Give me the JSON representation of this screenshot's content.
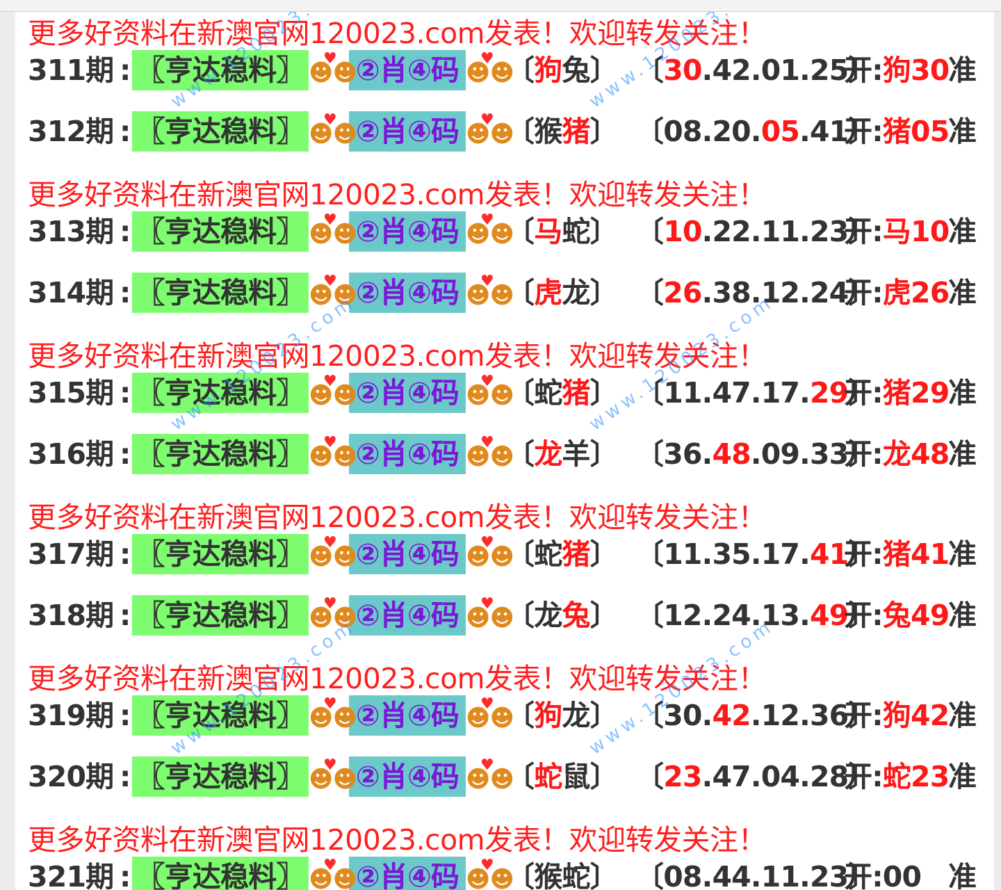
{
  "promo_text": "更多好资料在新澳官网120023.com发表！欢迎转发关注！",
  "tag_green": "〖亨达稳料〗",
  "tag_teal": "②肖④码",
  "open_label": "开:",
  "hit_label": "准",
  "watermark": "www.120023.com",
  "rows": [
    {
      "period": "311期",
      "a1": "狗",
      "a2": "兔",
      "n1": "30",
      "n2": "42",
      "n3": "01",
      "n4": "25",
      "open_animal": "狗",
      "open_num": "30",
      "hl": {
        "a1": true,
        "a2": false,
        "n1": true,
        "n2": false,
        "n3": false,
        "n4": false
      }
    },
    {
      "period": "312期",
      "a1": "猴",
      "a2": "猪",
      "n1": "08",
      "n2": "20",
      "n3": "05",
      "n4": "41",
      "open_animal": "猪",
      "open_num": "05",
      "hl": {
        "a1": false,
        "a2": true,
        "n1": false,
        "n2": false,
        "n3": true,
        "n4": false
      }
    },
    {
      "period": "313期",
      "a1": "马",
      "a2": "蛇",
      "n1": "10",
      "n2": "22",
      "n3": "11",
      "n4": "23",
      "open_animal": "马",
      "open_num": "10",
      "hl": {
        "a1": true,
        "a2": false,
        "n1": true,
        "n2": false,
        "n3": false,
        "n4": false
      }
    },
    {
      "period": "314期",
      "a1": "虎",
      "a2": "龙",
      "n1": "26",
      "n2": "38",
      "n3": "12",
      "n4": "24",
      "open_animal": "虎",
      "open_num": "26",
      "hl": {
        "a1": true,
        "a2": false,
        "n1": true,
        "n2": false,
        "n3": false,
        "n4": false
      }
    },
    {
      "period": "315期",
      "a1": "蛇",
      "a2": "猪",
      "n1": "11",
      "n2": "47",
      "n3": "17",
      "n4": "29",
      "open_animal": "猪",
      "open_num": "29",
      "hl": {
        "a1": false,
        "a2": true,
        "n1": false,
        "n2": false,
        "n3": false,
        "n4": true
      }
    },
    {
      "period": "316期",
      "a1": "龙",
      "a2": "羊",
      "n1": "36",
      "n2": "48",
      "n3": "09",
      "n4": "33",
      "open_animal": "龙",
      "open_num": "48",
      "hl": {
        "a1": true,
        "a2": false,
        "n1": false,
        "n2": true,
        "n3": false,
        "n4": false
      }
    },
    {
      "period": "317期",
      "a1": "蛇",
      "a2": "猪",
      "n1": "11",
      "n2": "35",
      "n3": "17",
      "n4": "41",
      "open_animal": "猪",
      "open_num": "41",
      "hl": {
        "a1": false,
        "a2": true,
        "n1": false,
        "n2": false,
        "n3": false,
        "n4": true
      }
    },
    {
      "period": "318期",
      "a1": "龙",
      "a2": "兔",
      "n1": "12",
      "n2": "24",
      "n3": "13",
      "n4": "49",
      "open_animal": "兔",
      "open_num": "49",
      "hl": {
        "a1": false,
        "a2": true,
        "n1": false,
        "n2": false,
        "n3": false,
        "n4": true
      }
    },
    {
      "period": "319期",
      "a1": "狗",
      "a2": "龙",
      "n1": "30",
      "n2": "42",
      "n3": "12",
      "n4": "36",
      "open_animal": "狗",
      "open_num": "42",
      "hl": {
        "a1": true,
        "a2": false,
        "n1": false,
        "n2": true,
        "n3": false,
        "n4": false
      }
    },
    {
      "period": "320期",
      "a1": "蛇",
      "a2": "鼠",
      "n1": "23",
      "n2": "47",
      "n3": "04",
      "n4": "28",
      "open_animal": "蛇",
      "open_num": "23",
      "hl": {
        "a1": true,
        "a2": false,
        "n1": true,
        "n2": false,
        "n3": false,
        "n4": false
      }
    },
    {
      "period": "321期",
      "a1": "猴",
      "a2": "蛇",
      "n1": "08",
      "n2": "44",
      "n3": "11",
      "n4": "23",
      "open_animal": "",
      "open_num": "00",
      "hl": {
        "a1": false,
        "a2": false,
        "n1": false,
        "n2": false,
        "n3": false,
        "n4": false
      }
    }
  ]
}
